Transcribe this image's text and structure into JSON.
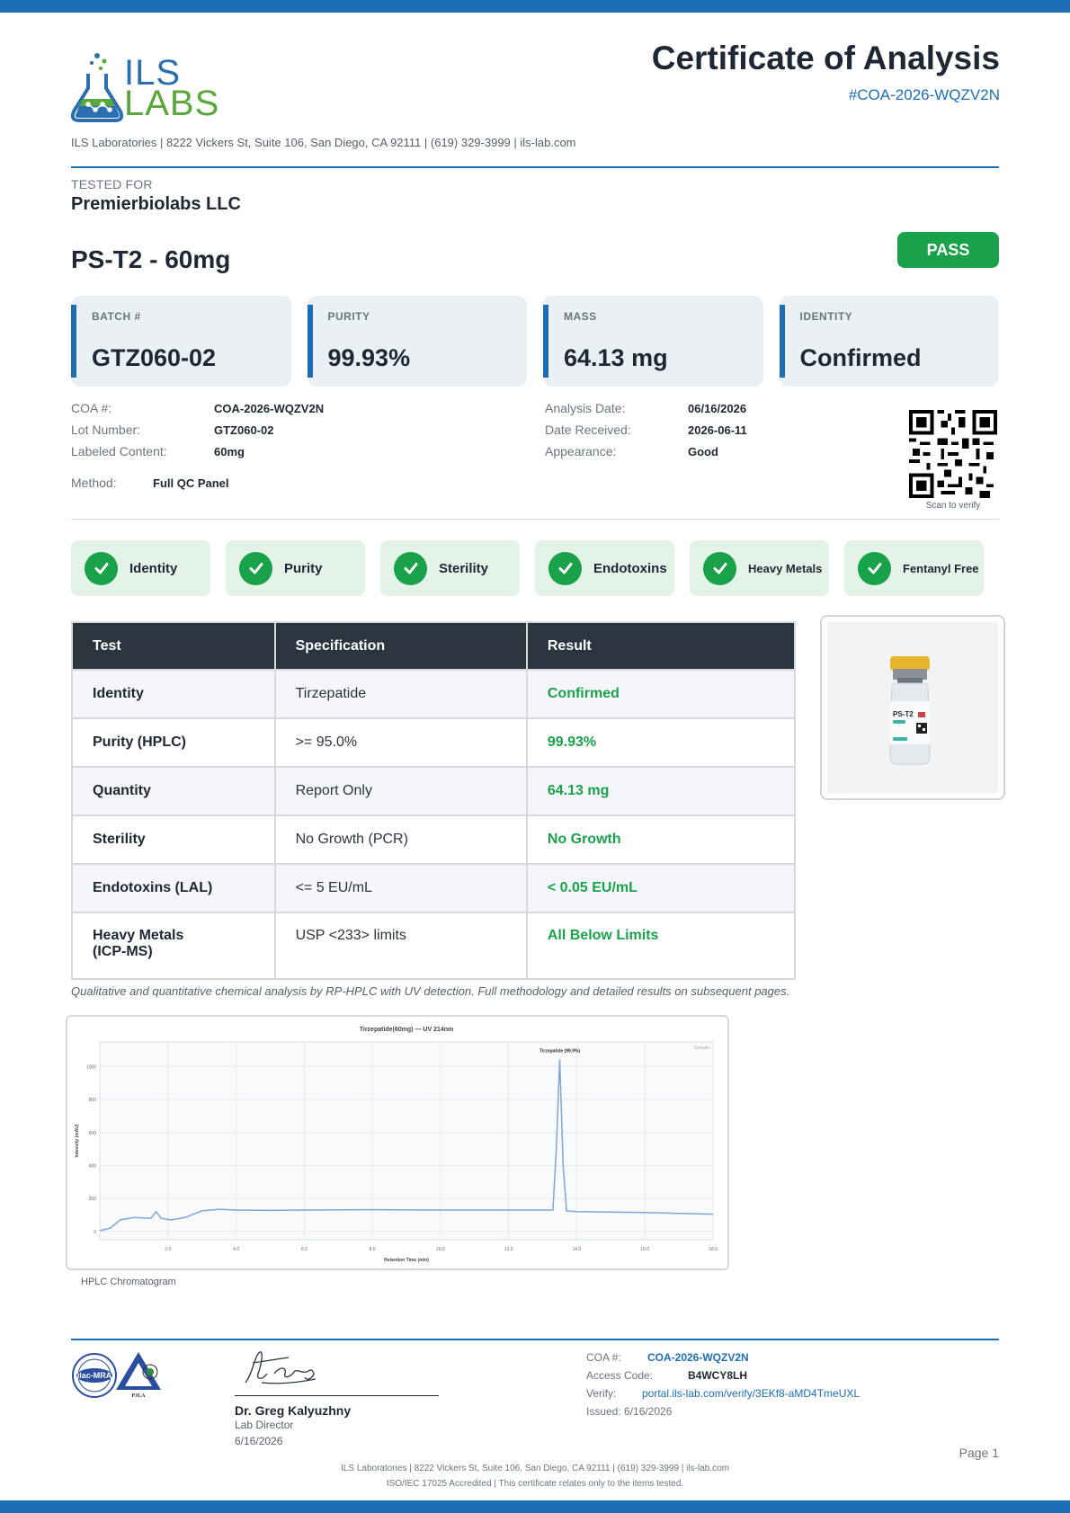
{
  "colors": {
    "brand": "#1d6fb5",
    "pass": "#19a24a",
    "dark": "#1e2733",
    "check_bg": "#e3f3e7",
    "card_bg": "#ebf0f5"
  },
  "header": {
    "logo_ils": "ILS",
    "logo_labs": "LABS",
    "title": "Certificate of Analysis",
    "coa_id": "#COA-2026-WQZV2N",
    "address": "ILS Laboratories  |  8222 Vickers St, Suite 106, San Diego, CA 92111  |  (619) 329-3999  |  ils-lab.com"
  },
  "tested_for": {
    "label": "TESTED FOR",
    "value": "Premierbiolabs LLC"
  },
  "product": {
    "name": "PS-T2 - 60mg",
    "status": "PASS"
  },
  "cards": [
    {
      "label": "BATCH #",
      "value": "GTZ060-02"
    },
    {
      "label": "PURITY",
      "value": "99.93%"
    },
    {
      "label": "MASS",
      "value": "64.13 mg"
    },
    {
      "label": "IDENTITY",
      "value": "Confirmed"
    }
  ],
  "info_left": [
    {
      "key": "COA #:",
      "value": "COA-2026-WQZV2N"
    },
    {
      "key": "Lot Number:",
      "value": "GTZ060-02"
    },
    {
      "key": "Labeled Content:",
      "value": "60mg"
    }
  ],
  "method": {
    "key": "Method:",
    "value": "Full QC Panel"
  },
  "info_right": [
    {
      "key": "Analysis Date:",
      "value": "06/16/2026"
    },
    {
      "key": "Date Received:",
      "value": "2026-06-11"
    },
    {
      "key": "Appearance:",
      "value": "Good"
    }
  ],
  "qr": {
    "label": "Scan to verify"
  },
  "checks": [
    {
      "label": "Identity"
    },
    {
      "label": "Purity"
    },
    {
      "label": "Sterility"
    },
    {
      "label": "Endotoxins"
    },
    {
      "label": "Heavy Metals"
    },
    {
      "label": "Fentanyl Free"
    }
  ],
  "results_table": {
    "headers": [
      "Test",
      "Specification",
      "Result"
    ],
    "rows": [
      {
        "test": "Identity",
        "spec": "Tirzepatide",
        "result": "Confirmed"
      },
      {
        "test": "Purity (HPLC)",
        "spec": ">= 95.0%",
        "result": "99.93%"
      },
      {
        "test": "Quantity",
        "spec": "Report Only",
        "result": "64.13 mg"
      },
      {
        "test": "Sterility",
        "spec": "No Growth (PCR)",
        "result": "No Growth"
      },
      {
        "test": "Endotoxins (LAL)",
        "spec": "<= 5 EU/mL",
        "result": "< 0.05 EU/mL"
      },
      {
        "test": "Heavy Metals (ICP-MS)",
        "spec": "USP <233> limits",
        "result": "All Below Limits"
      }
    ]
  },
  "vial": {
    "label": "PS-T2"
  },
  "note": "Qualitative and quantitative chemical analysis by RP-HPLC with UV detection. Full methodology and detailed results on subsequent pages.",
  "chart_data": {
    "type": "line",
    "title": "Tirzepatide(60mg) — UV 214nm",
    "xlabel": "Retention Time (min)",
    "ylabel": "Intensity (mAU)",
    "legend": "Sample",
    "legend_position": "top-right",
    "grid": true,
    "xlim": [
      0,
      18
    ],
    "ylim": [
      -50,
      1150
    ],
    "x_ticks": [
      "2.0",
      "4.0",
      "6.0",
      "8.0",
      "10.0",
      "12.0",
      "14.0",
      "16.0",
      "18.0"
    ],
    "y_ticks": [
      "0",
      "200",
      "400",
      "600",
      "800",
      "1000"
    ],
    "peak_label": "Tirzepatide (99.9%)",
    "series": [
      {
        "x": [
          0,
          0.3,
          0.6,
          1.0,
          1.5,
          1.65,
          1.8,
          2.1,
          2.5,
          3.0,
          3.5,
          4.0,
          5.0,
          6.0,
          8.0,
          10.0,
          12.0,
          13.3,
          13.4,
          13.5,
          13.6,
          13.7,
          14.0,
          15.0,
          16.0,
          17.0,
          18.0
        ],
        "y": [
          5,
          20,
          70,
          85,
          80,
          120,
          80,
          70,
          85,
          125,
          135,
          130,
          128,
          130,
          132,
          130,
          130,
          130,
          500,
          1045,
          400,
          125,
          120,
          118,
          115,
          110,
          105
        ]
      }
    ],
    "caption": "HPLC Chromatogram"
  },
  "footer": {
    "accreditation_seal_text": "PJLA",
    "signer_name": "Dr. Greg Kalyuzhny",
    "signer_role": "Lab Director",
    "signer_date": "6/16/2026",
    "coa_key": "COA #:",
    "coa_value": "COA-2026-WQZV2N",
    "access_key": "Access Code:",
    "access_value": "B4WCY8LH",
    "verify_key": "Verify:",
    "verify_value": "portal.ils-lab.com/verify/3EKf8-aMD4TmeUXL",
    "issued": "Issued: 6/16/2026",
    "page": "Page 1",
    "line1": "ILS Laboratories  |  8222 Vickers St, Suite 106, San Diego, CA 92111  |  (619) 329-3999  |  ils-lab.com",
    "line2": "ISO/IEC 17025 Accredited  |  This certificate relates only to the items tested."
  }
}
